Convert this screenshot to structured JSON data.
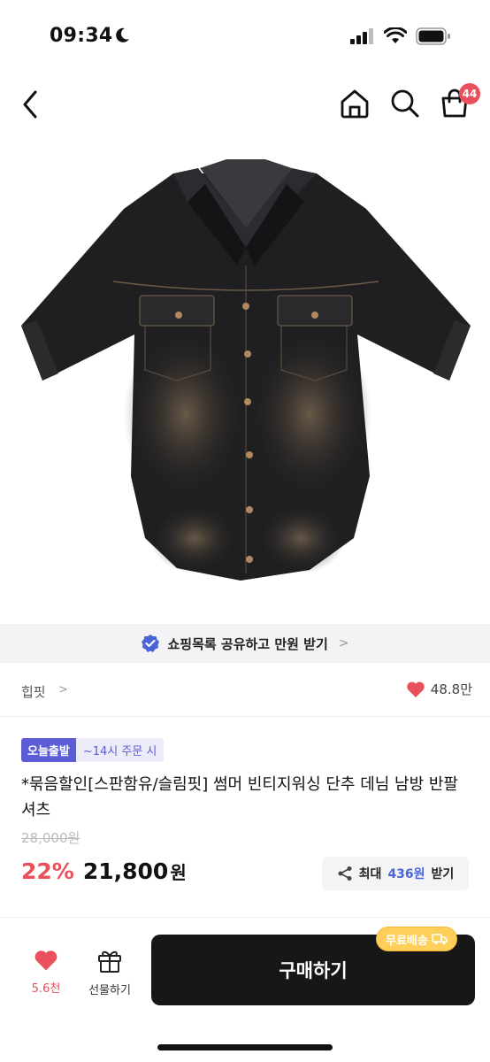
{
  "status_bar": {
    "time": "09:34"
  },
  "nav": {
    "cart_count": "44"
  },
  "share_banner": {
    "text": "쇼핑목록 공유하고 만원 받기",
    "chevron": ">"
  },
  "shop": {
    "name": "힙핏",
    "chevron": ">",
    "likes": "48.8만"
  },
  "tags": {
    "fast": "오늘출발",
    "deadline": "~14시 주문 시"
  },
  "product": {
    "title": "*묶음할인[스판함유/슬림핏] 썸머 빈티지워싱 단추 데님 남방 반팔셔츠",
    "original_price": "28,000원",
    "discount": "22%",
    "price": "21,800",
    "price_unit": "원"
  },
  "reward": {
    "prefix": "최대",
    "amount": "436원",
    "suffix": "받기"
  },
  "bottom_bar": {
    "wish_count": "5.6천",
    "gift_label": "선물하기",
    "buy_label": "구매하기",
    "free_shipping": "무료배송"
  },
  "icons": {
    "back": "chevron-left-icon",
    "home": "home-icon",
    "search": "search-icon",
    "cart": "shopping-bag-icon",
    "verified": "verified-badge-icon",
    "heart": "heart-icon",
    "share": "share-icon",
    "gift": "gift-icon",
    "truck": "truck-icon"
  },
  "colors": {
    "accent_red": "#e8505b",
    "accent_purple": "#5b5cd6",
    "buy_button": "#17171a",
    "free_ship": "#ffcf5c"
  }
}
